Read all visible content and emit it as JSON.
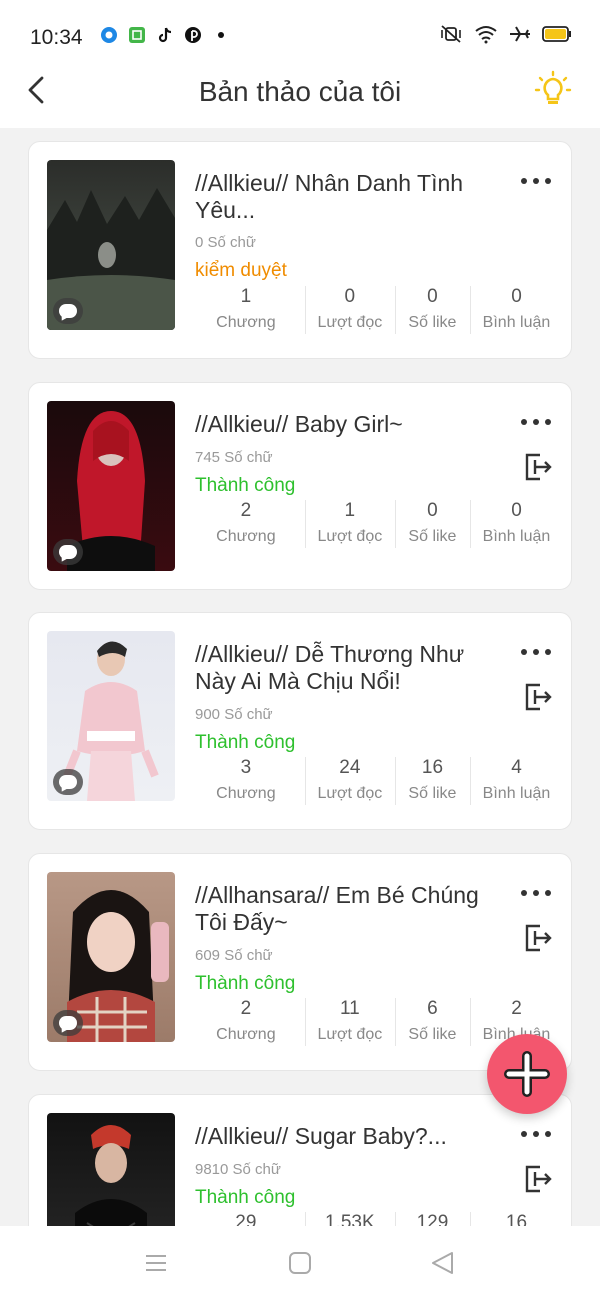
{
  "status_bar": {
    "time": "10:34",
    "left_icons": [
      "browser-icon",
      "app-icon",
      "tiktok-icon",
      "pinterest-icon",
      "dot-icon"
    ],
    "right_icons": [
      "vibrate-off-icon",
      "wifi-icon",
      "airplane-mode-icon",
      "battery-icon"
    ],
    "battery_color": "#f5c518"
  },
  "header": {
    "title": "Bản thảo của tôi",
    "back_icon": "chevron-left-icon",
    "hint_icon": "lightbulb-icon",
    "accent": "#f5c518"
  },
  "stat_labels": [
    "Chương",
    "Lượt đọc",
    "Số like",
    "Bình luận"
  ],
  "stories": [
    {
      "title": "//Allkieu// Nhân Danh Tình Yêu...",
      "word_count": "0 Số chữ",
      "status": "kiểm duyệt",
      "status_type": "pending",
      "has_export": false,
      "stats": [
        "1",
        "0",
        "0",
        "0"
      ],
      "cover_colors": [
        "#2b2d2a",
        "#6f7a70"
      ]
    },
    {
      "title": "//Allkieu// Baby Girl~",
      "word_count": "745 Số chữ",
      "status": "Thành công",
      "status_type": "success",
      "has_export": true,
      "stats": [
        "2",
        "1",
        "0",
        "0"
      ],
      "cover_colors": [
        "#1a0a0c",
        "#c0172a"
      ]
    },
    {
      "title": "//Allkieu// Dễ Thương Như Này Ai Mà Chịu Nổi!",
      "word_count": "900 Số chữ",
      "status": "Thành công",
      "status_type": "success",
      "has_export": true,
      "stats": [
        "3",
        "24",
        "16",
        "4"
      ],
      "cover_colors": [
        "#e6e8f0",
        "#f2c7cf"
      ]
    },
    {
      "title": "//Allhansara// Em Bé Chúng Tôi Đấy~",
      "word_count": "609 Số chữ",
      "status": "Thành công",
      "status_type": "success",
      "has_export": true,
      "stats": [
        "2",
        "11",
        "6",
        "2"
      ],
      "cover_colors": [
        "#b89886",
        "#b3473f"
      ]
    },
    {
      "title": "//Allkieu// Sugar Baby?...",
      "word_count": "9810 Số chữ",
      "status": "Thành công",
      "status_type": "success",
      "has_export": true,
      "stats": [
        "29",
        "1.53K",
        "129",
        "16"
      ],
      "cover_colors": [
        "#121212",
        "#7a2a22"
      ]
    }
  ],
  "fab": {
    "icon": "plus-icon",
    "color": "#f3566e"
  },
  "nav": {
    "icons": [
      "menu-icon",
      "home-square-icon",
      "back-triangle-icon"
    ]
  }
}
